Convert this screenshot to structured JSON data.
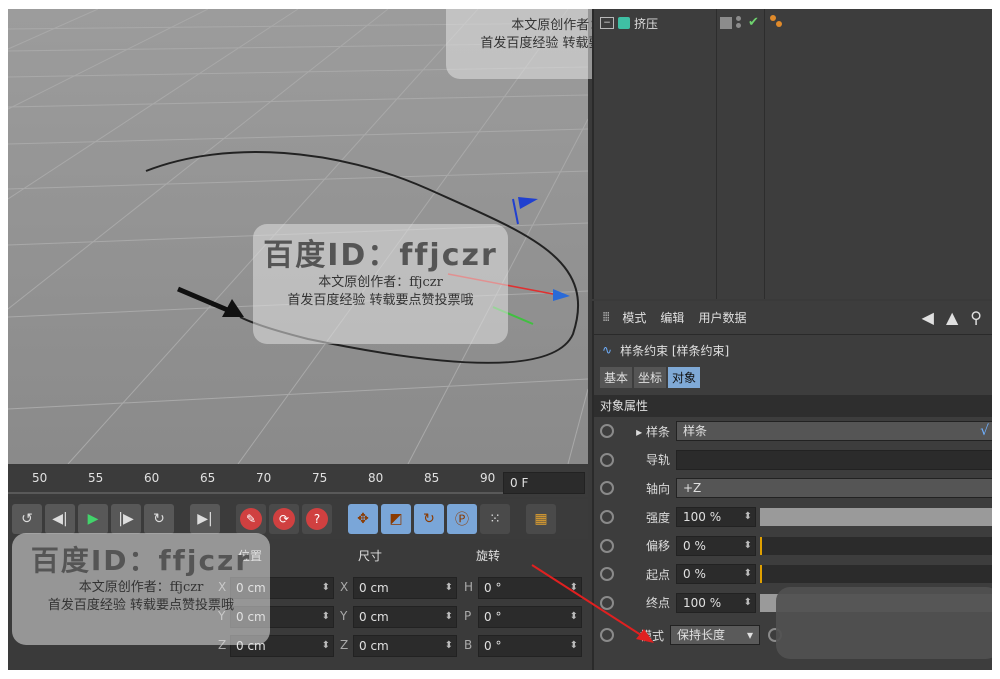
{
  "object_manager": {
    "object_name": "挤压",
    "expand_icon": "minus-box-icon"
  },
  "attributes": {
    "menu": [
      "模式",
      "编辑",
      "用户数据"
    ],
    "title": "样条约束 [样条约束]",
    "tabs": [
      "基本",
      "坐标",
      "对象"
    ],
    "section": "对象属性",
    "params": {
      "spline": {
        "label": "样条",
        "value": "样条"
      },
      "rail": {
        "label": "导轨",
        "value": ""
      },
      "axis": {
        "label": "轴向",
        "value": "+Z"
      },
      "strength": {
        "label": "强度",
        "value": "100 %",
        "level": 1.0
      },
      "offset": {
        "label": "偏移",
        "value": "0 %",
        "level": 0
      },
      "start": {
        "label": "起点",
        "value": "0 %",
        "level": 0
      },
      "end": {
        "label": "终点",
        "value": "100 %",
        "level": 1.0
      },
      "mode": {
        "label": "模式",
        "value": "保持长度"
      }
    }
  },
  "timeline": {
    "ticks": [
      "50",
      "55",
      "60",
      "65",
      "70",
      "75",
      "80",
      "85",
      "90"
    ],
    "frame": "0 F"
  },
  "coordinates": {
    "headers": {
      "position": "位置",
      "size": "尺寸",
      "rotation": "旋转"
    },
    "rows": [
      {
        "axis": "X",
        "pos": "0 cm",
        "size_axis": "X",
        "size": "0 cm",
        "rot_axis": "H",
        "rot": "0 °"
      },
      {
        "axis": "Y",
        "pos": "0 cm",
        "size_axis": "Y",
        "size": "0 cm",
        "rot_axis": "P",
        "rot": "0 °"
      },
      {
        "axis": "Z",
        "pos": "0 cm",
        "size_axis": "Z",
        "size": "0 cm",
        "rot_axis": "B",
        "rot": "0 °"
      }
    ]
  },
  "watermarks": {
    "id_text": "百度ID：ffjczr",
    "line1": "本文原创作者：ffjczr",
    "line2": "首发百度经验  转载要点赞投票哦",
    "top_line1": "本文原创作者：ffjczr",
    "top_line2": "首发百度经验  转载要点赞投票哦"
  },
  "colors": {
    "accent_blue": "#7fa9d6",
    "annotation_red": "#e02020",
    "play_green": "#42d36b"
  }
}
